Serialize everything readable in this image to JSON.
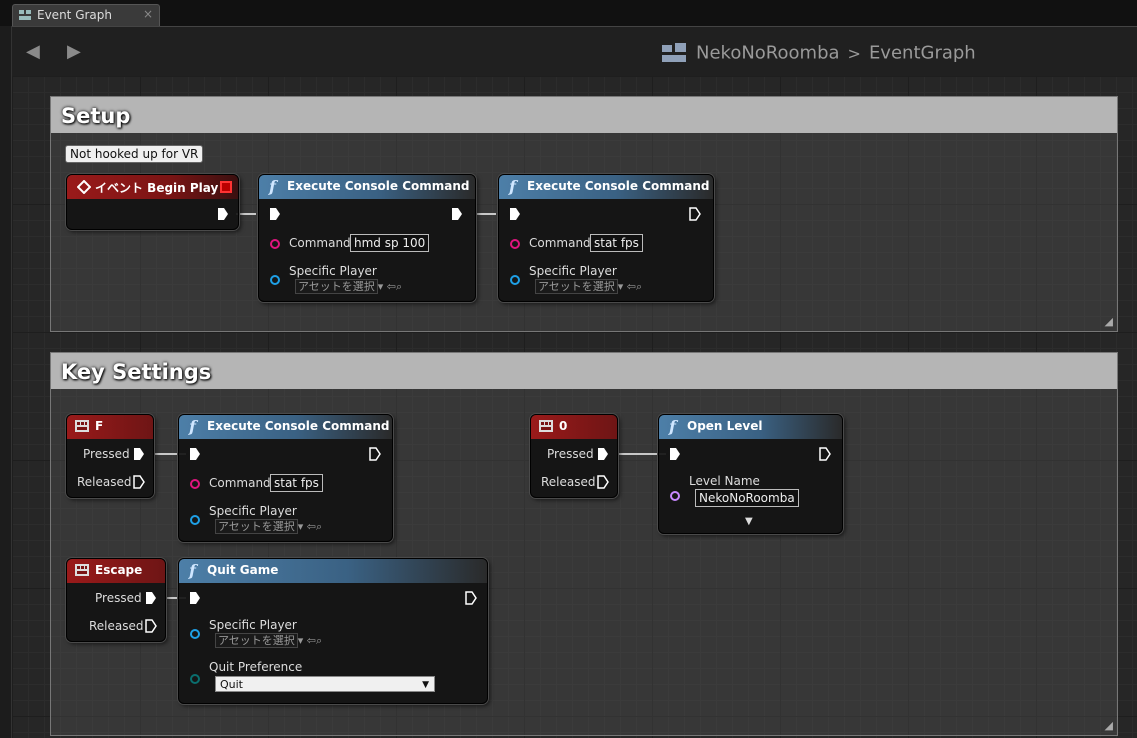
{
  "tab": {
    "label": "Event Graph",
    "close": "×"
  },
  "toolbar": {
    "back": "◀",
    "forward": "▶"
  },
  "breadcrumb": {
    "blueprint": "NekoNoRoomba",
    "separator": ">",
    "graph": "EventGraph"
  },
  "comments": [
    {
      "title": "Setup"
    },
    {
      "title": "Key Settings"
    }
  ],
  "tooltip": "Not hooked up for VR",
  "nodes": {
    "begin_play": {
      "title": "イベント Begin Play"
    },
    "exec1": {
      "title": "Execute Console Command",
      "command_label": "Command",
      "command": "hmd sp 100",
      "player_label": "Specific Player",
      "asset": "アセットを選択"
    },
    "exec2": {
      "title": "Execute Console Command",
      "command_label": "Command",
      "command": "stat fps",
      "player_label": "Specific Player",
      "asset": "アセットを選択"
    },
    "key_f": {
      "title": "F",
      "pressed": "Pressed",
      "released": "Released"
    },
    "exec3": {
      "title": "Execute Console Command",
      "command_label": "Command",
      "command": "stat fps",
      "player_label": "Specific Player",
      "asset": "アセットを選択"
    },
    "key_0": {
      "title": "0",
      "pressed": "Pressed",
      "released": "Released"
    },
    "open_level": {
      "title": "Open Level",
      "level_label": "Level Name",
      "level": "NekoNoRoomba"
    },
    "key_escape": {
      "title": "Escape",
      "pressed": "Pressed",
      "released": "Released"
    },
    "quit_game": {
      "title": "Quit Game",
      "player_label": "Specific Player",
      "asset": "アセットを選択",
      "pref_label": "Quit Preference",
      "pref": "Quit"
    }
  },
  "colors": {
    "exec_pin": "#ffffff",
    "string_pin": "#e0147e",
    "object_pin": "#1ea0e6",
    "name_pin": "#c888ff",
    "enum_pin": "#0a6e6e",
    "function_header": "#4d7fa8",
    "event_header": "#9a1a1a"
  }
}
